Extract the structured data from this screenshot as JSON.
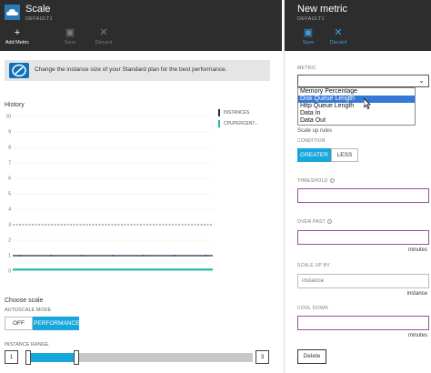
{
  "scale_blade": {
    "title": "Scale",
    "subtitle": "DEFAULT1",
    "commands": [
      {
        "label": "Add Metric",
        "icon": "plus-icon",
        "glyph": "+"
      },
      {
        "label": "Save",
        "icon": "save-icon",
        "glyph": "▣"
      },
      {
        "label": "Discard",
        "icon": "discard-icon",
        "glyph": "✕"
      }
    ],
    "banner_text": "Change the instance size of your Standard plan for the best performance.",
    "history_label": "History",
    "legend": [
      {
        "name": "INSTANCES",
        "color": "#1f2a44"
      },
      {
        "name": "CPUPERCENT...",
        "color": "#1fb89b"
      }
    ],
    "choose_scale": "Choose scale",
    "autoscale_mode_label": "AUTOSCALE MODE",
    "autoscale_options": [
      "OFF",
      "PERFORMANCE"
    ],
    "autoscale_selected": "PERFORMANCE",
    "instance_range_label": "INSTANCE RANGE",
    "instance_range": {
      "min": "1",
      "max": "3"
    }
  },
  "chart_data": {
    "type": "line",
    "yticks": [
      "10",
      "9",
      "8",
      "7",
      "6",
      "5",
      "4",
      "3",
      "2",
      "1",
      "0"
    ],
    "ylim": [
      0,
      10
    ],
    "threshold": 3,
    "series": [
      {
        "name": "INSTANCES",
        "color": "#1f2a44",
        "value": 1
      },
      {
        "name": "CPUPERCENT...",
        "color": "#1fb89b",
        "value": 0.1
      }
    ]
  },
  "metric_blade": {
    "title": "New metric",
    "subtitle": "DEFAULT1",
    "commands": [
      {
        "label": "Save",
        "icon": "save-icon",
        "glyph": "▣"
      },
      {
        "label": "Discard",
        "icon": "discard-icon",
        "glyph": "✕"
      }
    ],
    "metric_label": "METRIC",
    "metric_options": [
      "Memory Percentage",
      "Disk Queue Length",
      "Http Queue Length",
      "Data In",
      "Data Out"
    ],
    "metric_highlighted": "Disk Queue Length",
    "scale_up_rules": "Scale up rules",
    "condition_label": "CONDITION",
    "condition_options": [
      "GREATER",
      "LESS"
    ],
    "condition_selected": "GREATER",
    "threshold_label": "THRESHOLD",
    "over_past_label": "OVER PAST",
    "over_past_unit": "minutes",
    "scale_up_by_label": "SCALE UP BY",
    "scale_up_by_placeholder": "instance",
    "scale_up_by_unit": "instance",
    "cool_down_label": "COOL DOWN",
    "cool_down_unit": "minutes",
    "delete_label": "Delete"
  }
}
